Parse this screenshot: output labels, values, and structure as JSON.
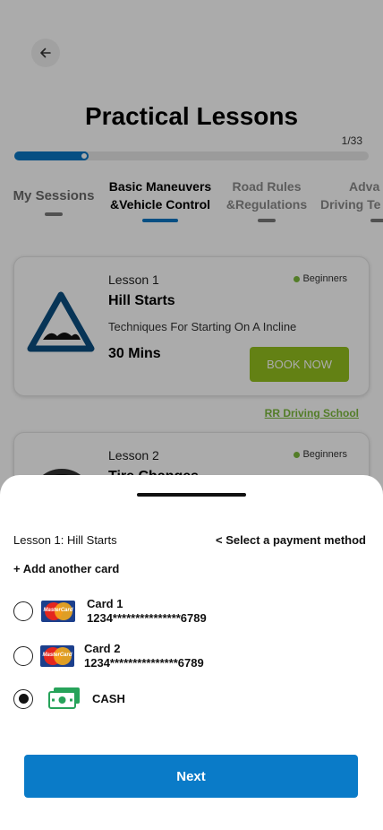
{
  "header": {
    "title": "Practical Lessons",
    "progress_text": "1/33",
    "progress_fraction": 0.03
  },
  "tabs": [
    {
      "line1": "My Sessions",
      "line2": ""
    },
    {
      "line1": "Basic Maneuvers",
      "line2": "&Vehicle Control"
    },
    {
      "line1": "Road Rules",
      "line2": "&Regulations"
    },
    {
      "line1": "Adva",
      "line2": "Driving Te"
    }
  ],
  "lessons": [
    {
      "number": "Lesson 1",
      "level": "Beginners",
      "title": "Hill Starts",
      "description": "Techniques For Starting On A Incline",
      "duration": "30 Mins",
      "button": "BOOK NOW",
      "school": "RR Driving School"
    },
    {
      "number": "Lesson 2",
      "level": "Beginners",
      "title": "Tire Changes"
    }
  ],
  "sheet": {
    "lesson_label": "Lesson 1: Hill Starts",
    "select_label": "< Select  a payment method",
    "add_card_label": "+ Add another card",
    "methods": [
      {
        "name": "Card 1",
        "number": "1234***************6789",
        "brand": "MasterCard",
        "selected": false
      },
      {
        "name": "Card 2",
        "number": "1234***************6789",
        "brand": "MasterCard",
        "selected": false
      },
      {
        "name": "CASH",
        "icon": "cash-icon",
        "selected": true
      }
    ],
    "next_label": "Next"
  },
  "colors": {
    "accent": "#0a7bc8",
    "book_button": "#94c11f",
    "level_dot": "#7dbb3c"
  }
}
